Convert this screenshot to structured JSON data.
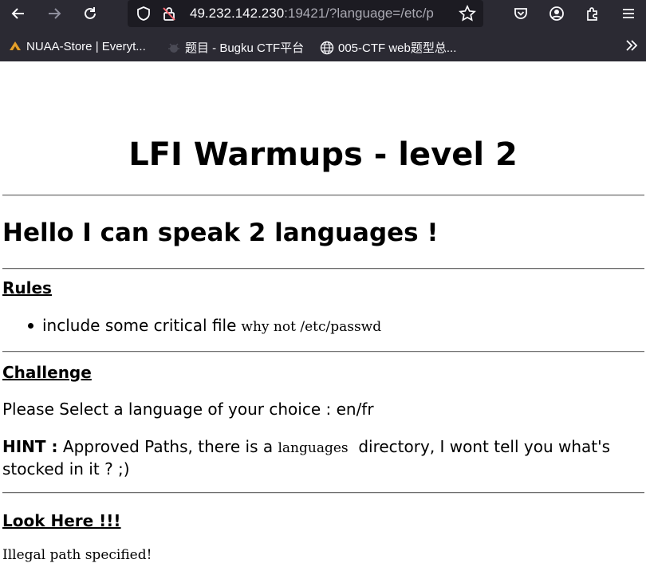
{
  "browser": {
    "url_host": "49.232.142.230",
    "url_path": ":19421/?language=/etc/p",
    "bookmarks": [
      {
        "label": "NUAA-Store | Everyt..."
      },
      {
        "label": "题目 - Bugku CTF平台"
      },
      {
        "label": "005-CTF web题型总..."
      }
    ]
  },
  "page": {
    "title": "LFI Warmups - level 2",
    "subtitle": "Hello I can speak 2 languages !",
    "rules": {
      "heading": "Rules",
      "item_text": "include some critical file",
      "item_code": "why not /etc/passwd"
    },
    "challenge": {
      "heading": "Challenge",
      "text": "Please Select a language of your choice : en/fr",
      "hint_label": "HINT :",
      "hint_before": "Approved Paths, there is a",
      "hint_code": "languages",
      "hint_after": "directory, I wont tell you what's stocked in it ? ;)"
    },
    "look_here": {
      "heading": "Look Here !!!",
      "output": "Illegal path specified!"
    }
  }
}
